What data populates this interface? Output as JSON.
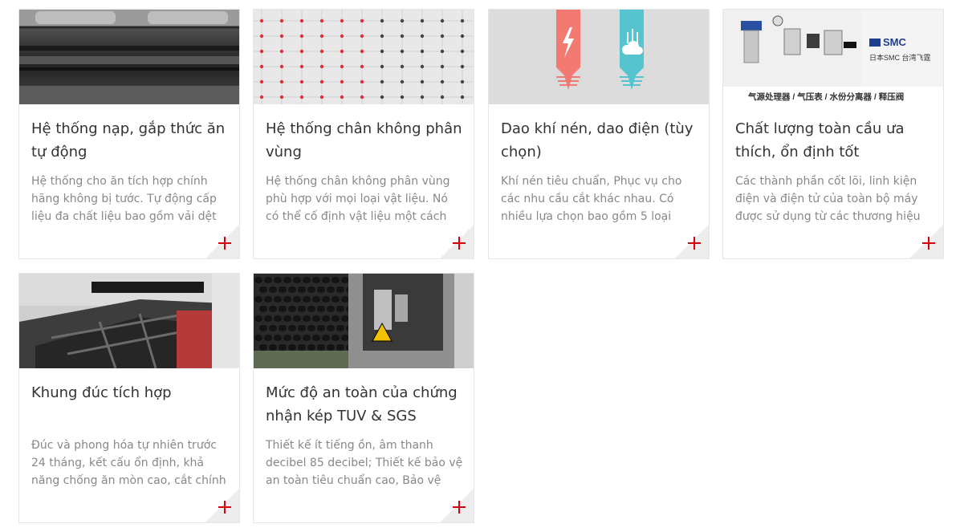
{
  "features": [
    {
      "title": "Hệ thống nạp, gắp thức ăn tự động",
      "description": "Hệ thống cho ăn tích hợp chính hãng không bị tước. Tự động cấp liệu đa chất liệu bao gồm vải dệt",
      "image": "feeding-belt-photo"
    },
    {
      "title": "Hệ thống chân không phân vùng",
      "description": "Hệ thống chân không phân vùng phù hợp với mọi loại vật liệu. Nó có thể cố định vật liệu một cách",
      "image": "vacuum-grid-photo"
    },
    {
      "title": "Dao khí nén, dao điện (tùy chọn)",
      "description": "Khí nén tiêu chuẩn, Phục vụ cho các nhu cầu cắt khác nhau. Có nhiều lựa chọn bao gồm 5 loại",
      "image": "knife-icons-graphic"
    },
    {
      "title": "Chất lượng toàn cầu ưa thích, ổn định tốt",
      "description": "Các thành phần cốt lõi, linh kiện điện và điện tử của toàn bộ máy được sử dụng từ các thương hiệu",
      "image": "smc-components-photo",
      "image_texts": {
        "brand": "SMC",
        "sub": "日本SMC   台湾飞霆",
        "caption": "气源处理器 / 气压表 / 水份分离器 / 释压阀"
      }
    },
    {
      "title": "Khung đúc tích hợp",
      "description": "Đúc và phong hóa tự nhiên trước 24 tháng, kết cấu ổn định, khả năng chống ăn mòn cao, cắt chính",
      "image": "cast-frame-photo"
    },
    {
      "title": "Mức độ an toàn của chứng nhận kép TUV & SGS",
      "description": "Thiết kế ít tiếng ồn, âm thanh decibel 85 decibel; Thiết kế bảo vệ an toàn tiêu chuẩn cao, Bảo vệ",
      "image": "safety-machine-photo"
    }
  ],
  "colors": {
    "accent_red": "#d8000f",
    "title_text": "#333333",
    "description_text": "#888888",
    "knife_red": "#f37a73",
    "knife_teal": "#56c4cf"
  }
}
